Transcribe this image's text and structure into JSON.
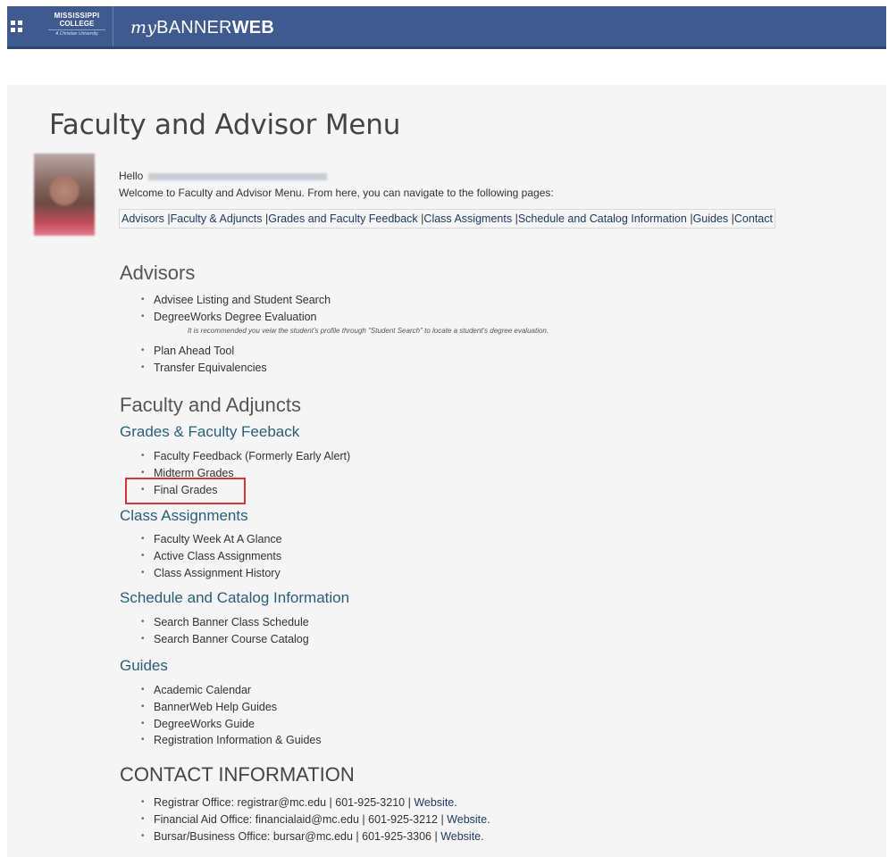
{
  "header": {
    "logo_line1": "MISSISSIPPI",
    "logo_line2": "COLLEGE",
    "logo_line3": "A Christian University",
    "brand_my": "my",
    "brand_banner": "BANNER",
    "brand_web": "WEB"
  },
  "page": {
    "title": "Faculty and Advisor Menu",
    "hello": "Hello",
    "welcome": "Welcome to Faculty and Advisor Menu. From here, you can navigate to the following pages:"
  },
  "nav": [
    "Advisors",
    "Faculty & Adjuncts",
    "Grades and Faculty Feedback",
    "Class Assigments",
    "Schedule and Catalog Information",
    "Guides",
    "Contact"
  ],
  "advisors": {
    "heading": "Advisors",
    "items": [
      "Advisee Listing and Student Search",
      "DegreeWorks Degree Evaluation",
      "Plan Ahead Tool",
      "Transfer Equivalencies"
    ],
    "note": "It is recommended you veiw the student's profile through \"Student Search\" to locate a student's degree evaluation."
  },
  "faculty": {
    "heading": "Faculty and Adjuncts",
    "grades_heading": "Grades & Faculty Feeback",
    "grades_items": [
      "Faculty Feedback (Formerly Early Alert)",
      "Midterm Grades",
      "Final Grades"
    ],
    "class_heading": "Class Assignments",
    "class_items": [
      "Faculty Week At A Glance",
      "Active Class Assignments",
      "Class Assignment History"
    ],
    "schedule_heading": "Schedule and Catalog Information",
    "schedule_items": [
      "Search Banner Class Schedule",
      "Search Banner Course Catalog"
    ],
    "guides_heading": "Guides",
    "guides_items": [
      "Academic Calendar",
      "BannerWeb Help Guides",
      "DegreeWorks Guide",
      "Registration Information & Guides"
    ]
  },
  "contact": {
    "heading": "CONTACT INFORMATION",
    "items": [
      {
        "text": "Registrar Office: registrar@mc.edu | 601-925-3210 | ",
        "link": "Website."
      },
      {
        "text": "Financial Aid Office: financialaid@mc.edu | 601-925-3212 | ",
        "link": "Website."
      },
      {
        "text": "Bursar/Business Office: bursar@mc.edu | 601-925-3306 | ",
        "link": "Website."
      }
    ]
  },
  "colors": {
    "header_bg": "#3f5a8e",
    "highlight": "#d0363a",
    "subheading": "#2a5f7a"
  }
}
